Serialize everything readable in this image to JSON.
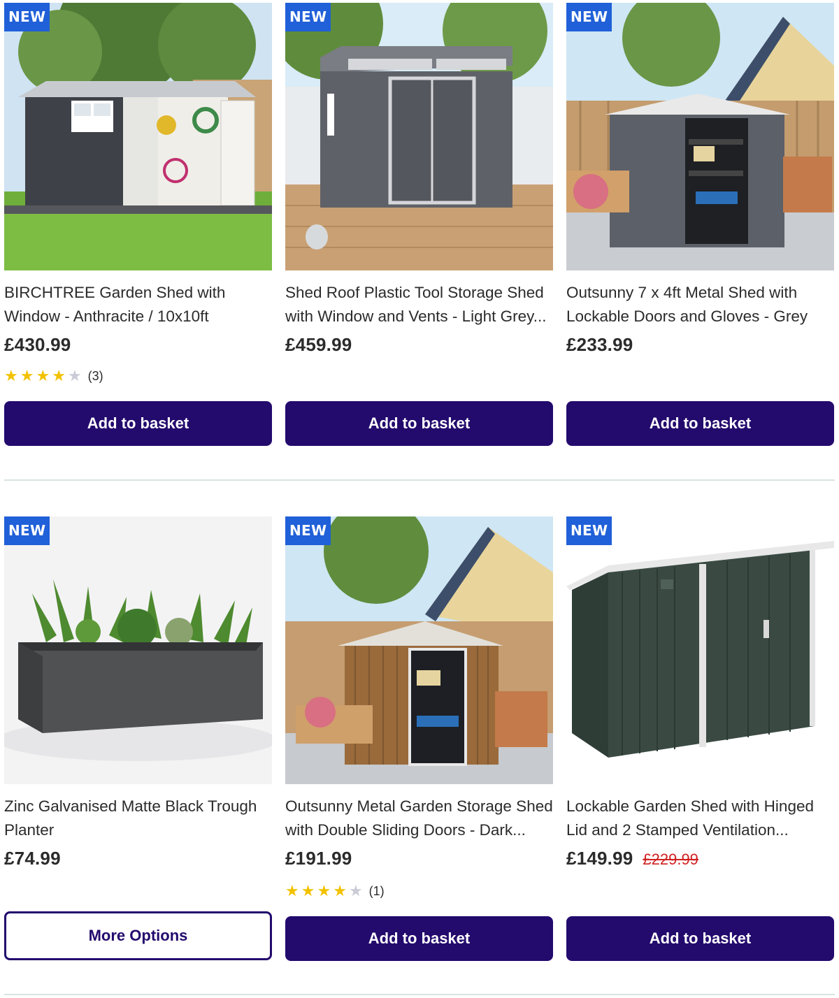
{
  "colors": {
    "badge": "#2060d8",
    "button_primary": "#230a6d",
    "star_full": "#f2c200",
    "star_empty": "#c9ccd6",
    "was_price": "#d12121"
  },
  "products": [
    {
      "badge": "NEW",
      "image": "anthracite-shed-on-lawn-image",
      "title": "BIRCHTREE Garden Shed with Window - Anthracite / 10x10ft",
      "price": "£430.99",
      "rating": {
        "stars": 4,
        "max": 5,
        "count": "(3)"
      },
      "button": "Add to basket"
    },
    {
      "badge": "NEW",
      "image": "grey-plastic-shed-on-decking-image",
      "title": "Shed Roof Plastic Tool Storage Shed with Window and Vents - Light Grey...",
      "price": "£459.99",
      "button": "Add to basket"
    },
    {
      "badge": "NEW",
      "image": "grey-metal-shed-open-doors-image",
      "title": "Outsunny 7 x 4ft Metal Shed with Lockable Doors and Gloves - Grey",
      "price": "£233.99",
      "button": "Add to basket"
    },
    {
      "badge": "NEW",
      "image": "black-trough-planter-image",
      "title": "Zinc Galvanised Matte Black Trough Planter",
      "price": "£74.99",
      "button": "More Options"
    },
    {
      "badge": "NEW",
      "image": "wood-effect-metal-shed-image",
      "title": "Outsunny Metal Garden Storage Shed with Double Sliding Doors - Dark...",
      "price": "£191.99",
      "rating": {
        "stars": 4,
        "max": 5,
        "count": "(1)"
      },
      "button": "Add to basket"
    },
    {
      "badge": "NEW",
      "image": "dark-green-lockable-shed-image",
      "title": "Lockable Garden Shed with Hinged Lid and 2 Stamped Ventilation...",
      "price": "£149.99",
      "was_price": "£229.99",
      "button": "Add to basket"
    }
  ]
}
